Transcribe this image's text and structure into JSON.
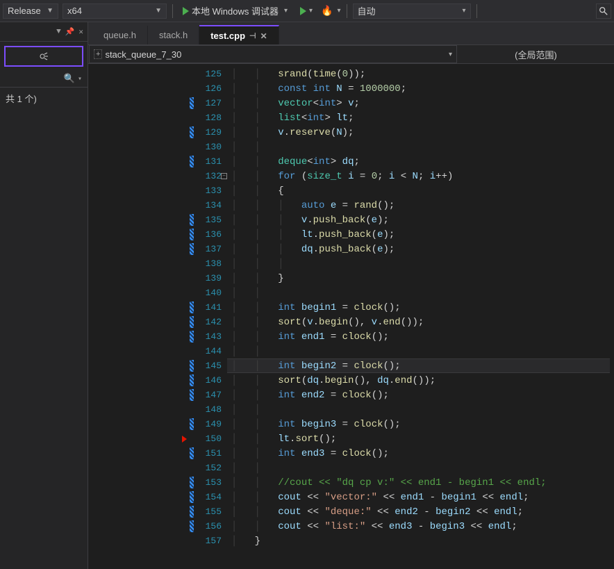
{
  "toolbar": {
    "config": "Release",
    "platform": "x64",
    "debug_label": "本地 Windows 调试器",
    "auto": "自动"
  },
  "left": {
    "count": "共 1 个)"
  },
  "tabs": [
    {
      "label": "queue.h",
      "active": false
    },
    {
      "label": "stack.h",
      "active": false
    },
    {
      "label": "test.cpp",
      "active": true
    }
  ],
  "scope": {
    "project": "stack_queue_7_30",
    "range": "(全局范围)"
  },
  "marked_lines": [
    127,
    129,
    131,
    135,
    136,
    137,
    141,
    142,
    143,
    145,
    146,
    147,
    149,
    151,
    153,
    154,
    155,
    156
  ],
  "breakpoint_line": 150,
  "current_line": 145,
  "lines": {
    "125": [
      [
        "f",
        "srand"
      ],
      [
        "o",
        "("
      ],
      [
        "f",
        "time"
      ],
      [
        "o",
        "("
      ],
      [
        "n",
        "0"
      ],
      [
        "o",
        "));"
      ]
    ],
    "126": [
      [
        "k",
        "const"
      ],
      [
        "d",
        " "
      ],
      [
        "k",
        "int"
      ],
      [
        "d",
        " "
      ],
      [
        "g",
        "N"
      ],
      [
        "d",
        " = "
      ],
      [
        "n",
        "1000000"
      ],
      [
        "o",
        ";"
      ]
    ],
    "127": [
      [
        "t",
        "vector"
      ],
      [
        "o",
        "<"
      ],
      [
        "k",
        "int"
      ],
      [
        "o",
        "> "
      ],
      [
        "g",
        "v"
      ],
      [
        "o",
        ";"
      ]
    ],
    "128": [
      [
        "t",
        "list"
      ],
      [
        "o",
        "<"
      ],
      [
        "k",
        "int"
      ],
      [
        "o",
        "> "
      ],
      [
        "g",
        "lt"
      ],
      [
        "o",
        ";"
      ]
    ],
    "129": [
      [
        "g",
        "v"
      ],
      [
        "o",
        "."
      ],
      [
        "f",
        "reserve"
      ],
      [
        "o",
        "("
      ],
      [
        "g",
        "N"
      ],
      [
        "o",
        ");"
      ]
    ],
    "130": [],
    "131": [
      [
        "t",
        "deque"
      ],
      [
        "o",
        "<"
      ],
      [
        "k",
        "int"
      ],
      [
        "o",
        "> "
      ],
      [
        "g",
        "dq"
      ],
      [
        "o",
        ";"
      ]
    ],
    "132": [
      [
        "k",
        "for"
      ],
      [
        "o",
        " ("
      ],
      [
        "t",
        "size_t"
      ],
      [
        "d",
        " "
      ],
      [
        "g",
        "i"
      ],
      [
        "d",
        " = "
      ],
      [
        "n",
        "0"
      ],
      [
        "o",
        "; "
      ],
      [
        "g",
        "i"
      ],
      [
        "d",
        " < "
      ],
      [
        "g",
        "N"
      ],
      [
        "o",
        "; "
      ],
      [
        "g",
        "i"
      ],
      [
        "o",
        "++)"
      ]
    ],
    "133": [
      [
        "o",
        "{"
      ]
    ],
    "134": [
      [
        "k",
        "auto"
      ],
      [
        "d",
        " "
      ],
      [
        "g",
        "e"
      ],
      [
        "d",
        " = "
      ],
      [
        "f",
        "rand"
      ],
      [
        "o",
        "();"
      ]
    ],
    "135": [
      [
        "g",
        "v"
      ],
      [
        "o",
        "."
      ],
      [
        "f",
        "push_back"
      ],
      [
        "o",
        "("
      ],
      [
        "g",
        "e"
      ],
      [
        "o",
        ");"
      ]
    ],
    "136": [
      [
        "g",
        "lt"
      ],
      [
        "o",
        "."
      ],
      [
        "f",
        "push_back"
      ],
      [
        "o",
        "("
      ],
      [
        "g",
        "e"
      ],
      [
        "o",
        ");"
      ]
    ],
    "137": [
      [
        "g",
        "dq"
      ],
      [
        "o",
        "."
      ],
      [
        "f",
        "push_back"
      ],
      [
        "o",
        "("
      ],
      [
        "g",
        "e"
      ],
      [
        "o",
        ");"
      ]
    ],
    "138": [],
    "139": [
      [
        "o",
        "}"
      ]
    ],
    "140": [],
    "141": [
      [
        "k",
        "int"
      ],
      [
        "d",
        " "
      ],
      [
        "g",
        "begin1"
      ],
      [
        "d",
        " = "
      ],
      [
        "f",
        "clock"
      ],
      [
        "o",
        "();"
      ]
    ],
    "142": [
      [
        "f",
        "sort"
      ],
      [
        "o",
        "("
      ],
      [
        "g",
        "v"
      ],
      [
        "o",
        "."
      ],
      [
        "f",
        "begin"
      ],
      [
        "o",
        "(), "
      ],
      [
        "g",
        "v"
      ],
      [
        "o",
        "."
      ],
      [
        "f",
        "end"
      ],
      [
        "o",
        "());"
      ]
    ],
    "143": [
      [
        "k",
        "int"
      ],
      [
        "d",
        " "
      ],
      [
        "g",
        "end1"
      ],
      [
        "d",
        " = "
      ],
      [
        "f",
        "clock"
      ],
      [
        "o",
        "();"
      ]
    ],
    "144": [],
    "145": [
      [
        "k",
        "int"
      ],
      [
        "d",
        " "
      ],
      [
        "g",
        "begin2"
      ],
      [
        "d",
        " = "
      ],
      [
        "f",
        "clock"
      ],
      [
        "o",
        "();"
      ]
    ],
    "146": [
      [
        "f",
        "sort"
      ],
      [
        "o",
        "("
      ],
      [
        "g",
        "dq"
      ],
      [
        "o",
        "."
      ],
      [
        "f",
        "begin"
      ],
      [
        "o",
        "(), "
      ],
      [
        "g",
        "dq"
      ],
      [
        "o",
        "."
      ],
      [
        "f",
        "end"
      ],
      [
        "o",
        "());"
      ]
    ],
    "147": [
      [
        "k",
        "int"
      ],
      [
        "d",
        " "
      ],
      [
        "g",
        "end2"
      ],
      [
        "d",
        " = "
      ],
      [
        "f",
        "clock"
      ],
      [
        "o",
        "();"
      ]
    ],
    "148": [],
    "149": [
      [
        "k",
        "int"
      ],
      [
        "d",
        " "
      ],
      [
        "g",
        "begin3"
      ],
      [
        "d",
        " = "
      ],
      [
        "f",
        "clock"
      ],
      [
        "o",
        "();"
      ]
    ],
    "150": [
      [
        "g",
        "lt"
      ],
      [
        "o",
        "."
      ],
      [
        "f",
        "sort"
      ],
      [
        "o",
        "();"
      ]
    ],
    "151": [
      [
        "k",
        "int"
      ],
      [
        "d",
        " "
      ],
      [
        "g",
        "end3"
      ],
      [
        "d",
        " = "
      ],
      [
        "f",
        "clock"
      ],
      [
        "o",
        "();"
      ]
    ],
    "152": [],
    "153": [
      [
        "c",
        "//cout << \"dq cp v:\" << end1 - begin1 << endl;"
      ]
    ],
    "154": [
      [
        "g",
        "cout"
      ],
      [
        "d",
        " << "
      ],
      [
        "s",
        "\"vector:\""
      ],
      [
        "d",
        " << "
      ],
      [
        "g",
        "end1"
      ],
      [
        "d",
        " - "
      ],
      [
        "g",
        "begin1"
      ],
      [
        "d",
        " << "
      ],
      [
        "g",
        "endl"
      ],
      [
        "o",
        ";"
      ]
    ],
    "155": [
      [
        "g",
        "cout"
      ],
      [
        "d",
        " << "
      ],
      [
        "s",
        "\"deque:\""
      ],
      [
        "d",
        " << "
      ],
      [
        "g",
        "end2"
      ],
      [
        "d",
        " - "
      ],
      [
        "g",
        "begin2"
      ],
      [
        "d",
        " << "
      ],
      [
        "g",
        "endl"
      ],
      [
        "o",
        ";"
      ]
    ],
    "156": [
      [
        "g",
        "cout"
      ],
      [
        "d",
        " << "
      ],
      [
        "s",
        "\"list:\""
      ],
      [
        "d",
        " << "
      ],
      [
        "g",
        "end3"
      ],
      [
        "d",
        " - "
      ],
      [
        "g",
        "begin3"
      ],
      [
        "d",
        " << "
      ],
      [
        "g",
        "endl"
      ],
      [
        "o",
        ";"
      ]
    ],
    "157": [
      [
        "o",
        "}"
      ]
    ]
  },
  "indent": {
    "125": 2,
    "126": 2,
    "127": 2,
    "128": 2,
    "129": 2,
    "130": 2,
    "131": 2,
    "132": 2,
    "133": 2,
    "134": 3,
    "135": 3,
    "136": 3,
    "137": 3,
    "138": 3,
    "139": 2,
    "140": 2,
    "141": 2,
    "142": 2,
    "143": 2,
    "144": 2,
    "145": 2,
    "146": 2,
    "147": 2,
    "148": 2,
    "149": 2,
    "150": 2,
    "151": 2,
    "152": 2,
    "153": 2,
    "154": 2,
    "155": 2,
    "156": 2,
    "157": 1
  }
}
